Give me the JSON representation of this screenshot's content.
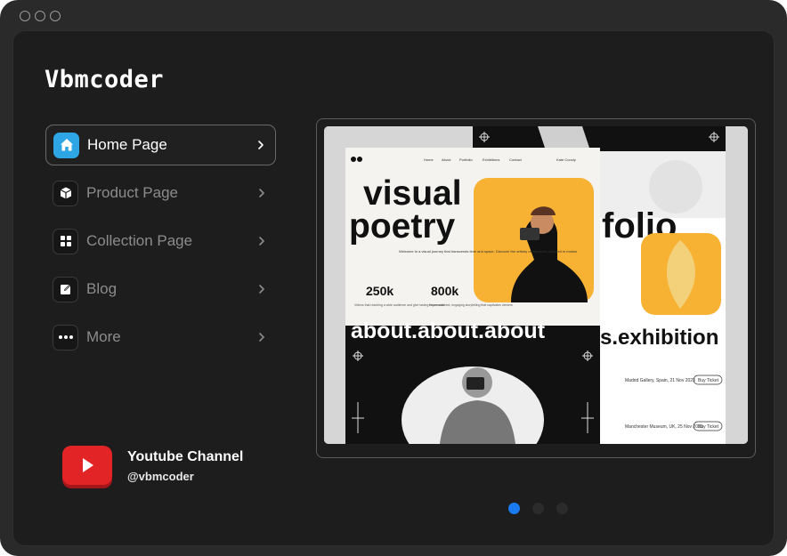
{
  "brand": "Vbmcoder",
  "nav": [
    {
      "label": "Home Page",
      "icon": "home-icon",
      "active": true
    },
    {
      "label": "Product Page",
      "icon": "box-icon",
      "active": false
    },
    {
      "label": "Collection Page",
      "icon": "grid-icon",
      "active": false
    },
    {
      "label": "Blog",
      "icon": "edit-icon",
      "active": false
    },
    {
      "label": "More",
      "icon": "more-icon",
      "active": false
    }
  ],
  "youtube": {
    "title": "Youtube Channel",
    "handle": "@vbmcoder"
  },
  "preview": {
    "headline_1": "visual",
    "headline_2": "poetry",
    "nav_links": [
      "Home",
      "About",
      "Portfolio",
      "Exhibitions",
      "Contact"
    ],
    "intro": "Welcome to a visual journey that transcends time and space. Discover the artistry of moments captured in motion",
    "stat_1_value": "250k",
    "stat_1_text": "Videos that reaching a wide audience and give lasting impression",
    "stat_2_value": "800k",
    "stat_2_text": "Hours watched, engaging storytelling that captivates viewers",
    "about_strip": "about.about.about",
    "folio": "folio",
    "exhibition_strip": "s.exhibition",
    "event_1": "Madrid Gallery, Spain, 21 Nov 2023",
    "event_2": "Manchester Museum, UK, 25 Nov 2023",
    "ticket": "Buy Ticket",
    "user": "Kate Conoly"
  },
  "carousel": {
    "count": 3,
    "active_index": 0
  },
  "colors": {
    "accent": "#1a7bf0",
    "home_icon": "#2ea6e6",
    "youtube": "#e32426",
    "preview_orange": "#f7b234"
  }
}
